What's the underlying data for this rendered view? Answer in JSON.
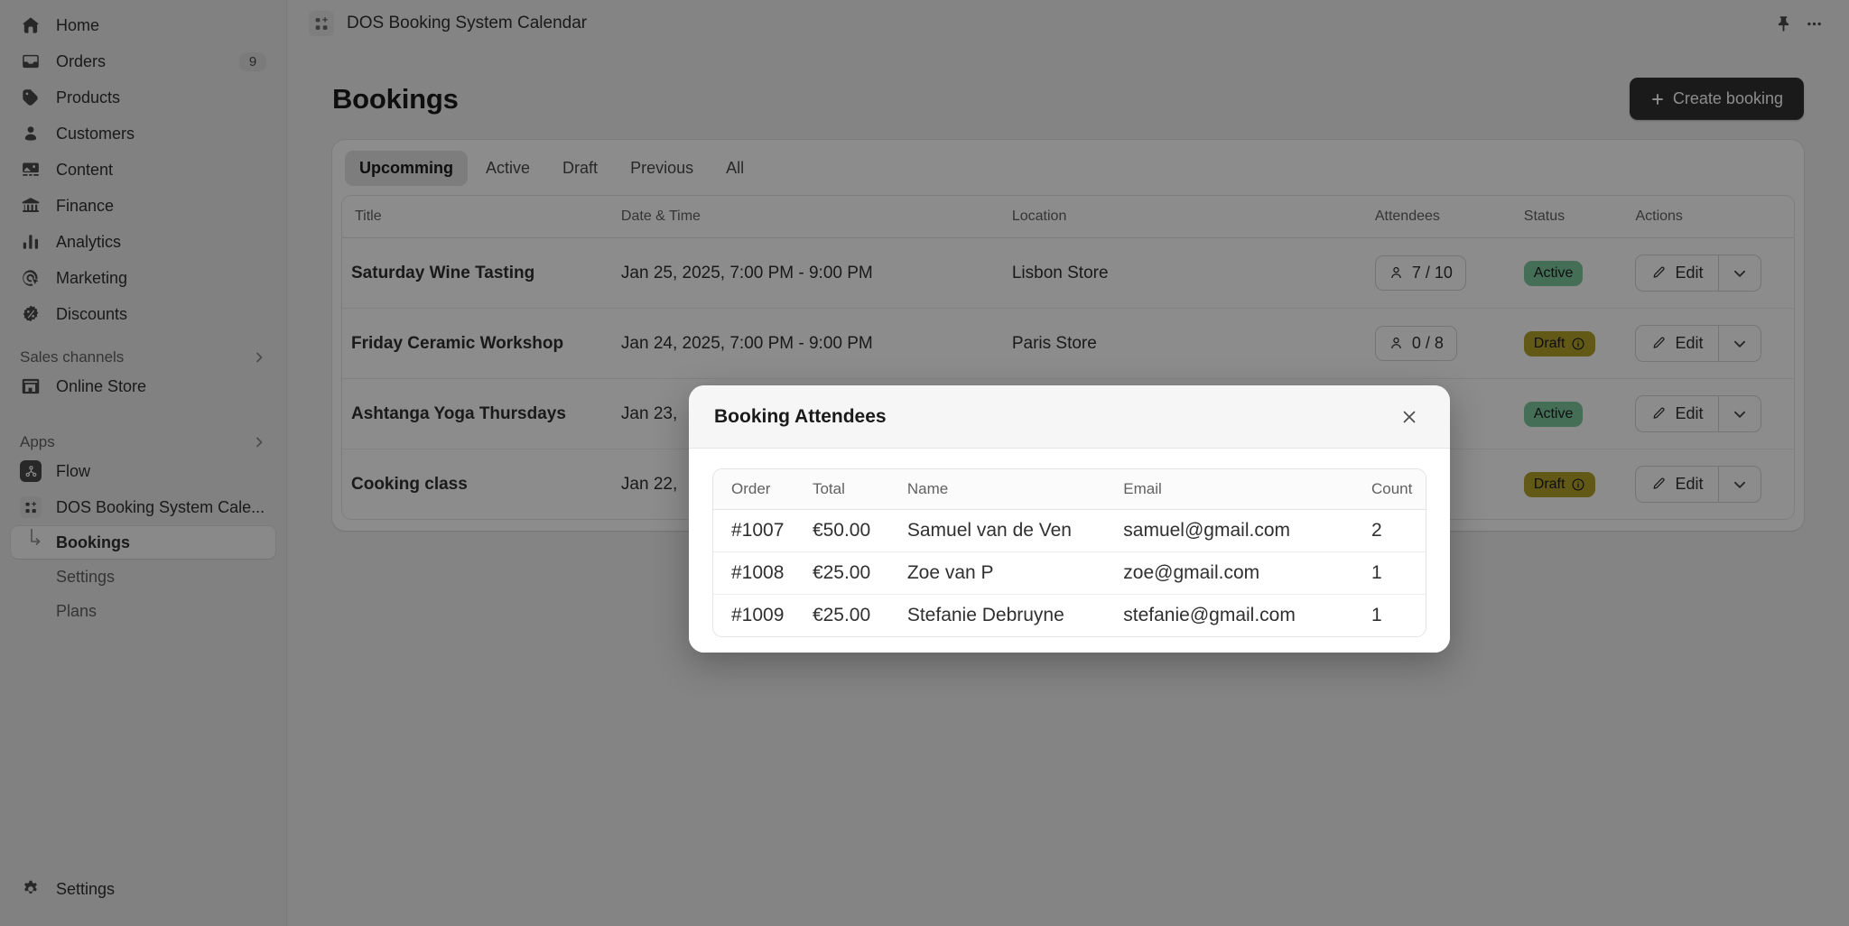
{
  "sidebar": {
    "items": [
      {
        "label": "Home",
        "icon": "home-icon",
        "badge": ""
      },
      {
        "label": "Orders",
        "icon": "orders-icon",
        "badge": "9"
      },
      {
        "label": "Products",
        "icon": "products-icon",
        "badge": ""
      },
      {
        "label": "Customers",
        "icon": "customers-icon",
        "badge": ""
      },
      {
        "label": "Content",
        "icon": "content-icon",
        "badge": ""
      },
      {
        "label": "Finance",
        "icon": "finance-icon",
        "badge": ""
      },
      {
        "label": "Analytics",
        "icon": "analytics-icon",
        "badge": ""
      },
      {
        "label": "Marketing",
        "icon": "marketing-icon",
        "badge": ""
      },
      {
        "label": "Discounts",
        "icon": "discounts-icon",
        "badge": ""
      }
    ],
    "sales_channels": {
      "label": "Sales channels",
      "chevron": "chevron-right-icon"
    },
    "online_store": {
      "label": "Online Store",
      "icon": "storefront-icon"
    },
    "apps": {
      "label": "Apps",
      "chevron": "chevron-right-icon"
    },
    "flow": {
      "label": "Flow",
      "icon": "flow-icon"
    },
    "app_entry": {
      "label": "DOS Booking System Cale...",
      "icon": "app-grid-icon"
    },
    "sub_items": [
      {
        "label": "Bookings",
        "active": true
      },
      {
        "label": "Settings",
        "active": false
      },
      {
        "label": "Plans",
        "active": false
      }
    ],
    "settings": {
      "label": "Settings",
      "icon": "gear-icon"
    }
  },
  "topbar": {
    "app_icon": "app-grid-icon",
    "title": "DOS Booking System Calendar",
    "pin_icon": "pin-icon",
    "more_icon": "ellipsis-icon"
  },
  "page": {
    "title": "Bookings",
    "create_button": {
      "label": "Create booking",
      "icon": "plus-icon"
    }
  },
  "tabs": [
    {
      "label": "Upcomming",
      "active": true
    },
    {
      "label": "Active",
      "active": false
    },
    {
      "label": "Draft",
      "active": false
    },
    {
      "label": "Previous",
      "active": false
    },
    {
      "label": "All",
      "active": false
    }
  ],
  "bookings_table": {
    "columns": [
      "Title",
      "Date & Time",
      "Location",
      "Attendees",
      "Status",
      "Actions"
    ],
    "rows": [
      {
        "title": "Saturday Wine Tasting",
        "datetime": "Jan 25, 2025, 7:00 PM - 9:00 PM",
        "location": "Lisbon Store",
        "attendees": "7 / 10",
        "status": "Active",
        "status_kind": "active",
        "status_info": false,
        "edit_label": "Edit"
      },
      {
        "title": "Friday Ceramic Workshop",
        "datetime": "Jan 24, 2025, 7:00 PM - 9:00 PM",
        "location": "Paris Store",
        "attendees": "0 / 8",
        "status": "Draft",
        "status_kind": "draft",
        "status_info": true,
        "edit_label": "Edit"
      },
      {
        "title": "Ashtanga Yoga Thursdays",
        "datetime": "Jan 23,",
        "location": "",
        "attendees": "",
        "status": "Active",
        "status_kind": "active",
        "status_info": false,
        "edit_label": "Edit"
      },
      {
        "title": "Cooking class",
        "datetime": "Jan 22,",
        "location": "",
        "attendees": "",
        "status": "Draft",
        "status_kind": "draft",
        "status_info": true,
        "edit_label": "Edit"
      }
    ]
  },
  "modal": {
    "title": "Booking Attendees",
    "close_icon": "close-icon",
    "columns": [
      "Order",
      "Total",
      "Name",
      "Email",
      "Count"
    ],
    "rows": [
      {
        "order": "#1007",
        "total": "€50.00",
        "name": "Samuel van de Ven",
        "email": "samuel@gmail.com",
        "count": "2"
      },
      {
        "order": "#1008",
        "total": "€25.00",
        "name": "Zoe van P",
        "email": "zoe@gmail.com",
        "count": "1"
      },
      {
        "order": "#1009",
        "total": "€25.00",
        "name": "Stefanie Debruyne",
        "email": "stefanie@gmail.com",
        "count": "1"
      }
    ]
  },
  "colors": {
    "accent_dark": "#303030",
    "status_active": "#7ec99e",
    "status_draft": "#b5a229",
    "sidebar_bg": "#ebebeb",
    "page_bg": "#f1f1f1"
  }
}
